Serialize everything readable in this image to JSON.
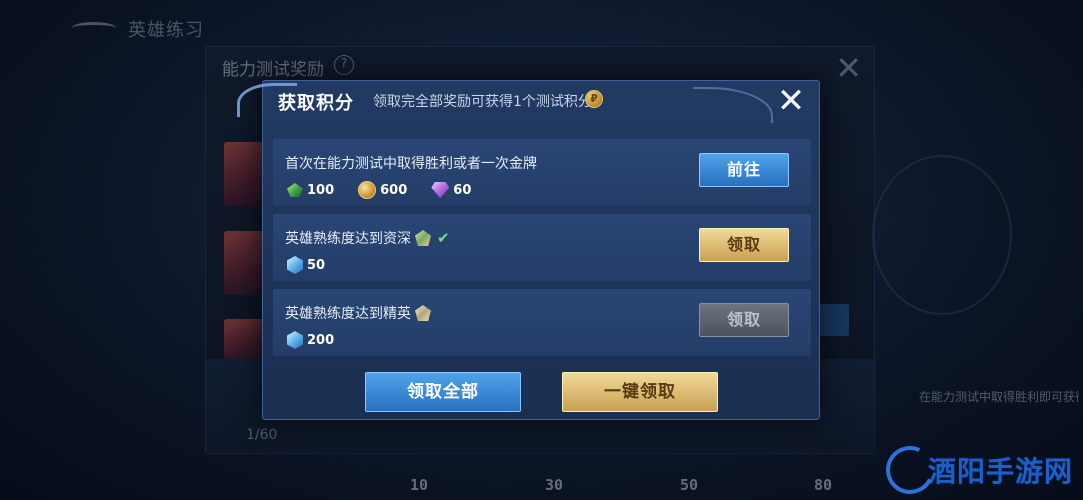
{
  "background": {
    "topbar_title": "英雄练习",
    "panel_title": "能力测试奖励",
    "help_icon": "?",
    "progress_label": "1/60",
    "milestones": [
      "10",
      "30",
      "50",
      "80"
    ],
    "side_text": "在能力测试中取得胜利即可获得积分"
  },
  "modal": {
    "title": "获取积分",
    "subtitle": "领取完全部奖励可获得1个测试积分",
    "coin_icon": "coin-icon",
    "close_icon": "close-icon",
    "tasks": [
      {
        "description": "首次在能力测试中取得胜利或者一次金牌",
        "rewards": [
          {
            "icon": "emerald-icon",
            "value": "100"
          },
          {
            "icon": "gold-coin-icon",
            "value": "600"
          },
          {
            "icon": "diamond-icon",
            "value": "60"
          }
        ],
        "button_label": "前往",
        "button_state": "go"
      },
      {
        "description": "英雄熟练度达到资深",
        "badge": "senior-rank-icon",
        "completed": true,
        "rewards": [
          {
            "icon": "crystal-icon",
            "value": "50"
          }
        ],
        "button_label": "领取",
        "button_state": "claimable"
      },
      {
        "description": "英雄熟练度达到精英",
        "badge": "elite-rank-icon",
        "completed": false,
        "rewards": [
          {
            "icon": "crystal-icon",
            "value": "200"
          }
        ],
        "button_label": "领取",
        "button_state": "disabled"
      }
    ],
    "footer": {
      "claim_all_label": "领取全部",
      "one_click_label": "一键领取"
    }
  },
  "watermark": {
    "text": "酒阳手游网"
  },
  "colors": {
    "modal_bg": "#1f3557",
    "button_blue": "#3a8ad6",
    "button_gold": "#dcba72",
    "button_disabled": "#5d646e",
    "check_green": "#6fe07a"
  }
}
